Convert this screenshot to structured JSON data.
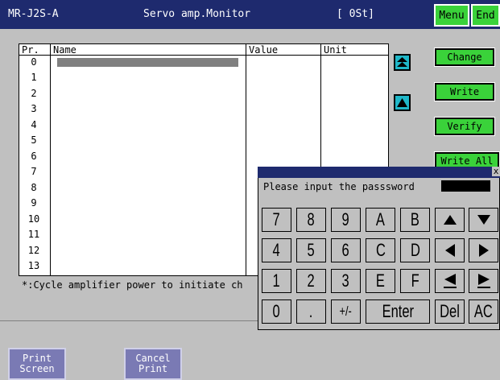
{
  "header": {
    "model": "MR-J2S-A",
    "title": "Servo amp.Monitor",
    "status": "[ 0St]",
    "menu_label": "Menu",
    "end_label": "End"
  },
  "table": {
    "columns": [
      "Pr.",
      "Name",
      "Value",
      "Unit"
    ],
    "rows": [
      "0",
      "1",
      "2",
      "3",
      "4",
      "5",
      "6",
      "7",
      "8",
      "9",
      "10",
      "11",
      "12",
      "13"
    ]
  },
  "side_buttons": {
    "change": "Change",
    "write": "Write",
    "verify": "Verify",
    "write_all": "Write All"
  },
  "note": "*:Cycle amplifier power to initiate ch",
  "footer": {
    "print_screen": [
      "Print",
      "Screen"
    ],
    "cancel_print": [
      "Cancel",
      "Print"
    ]
  },
  "dialog": {
    "close": "x",
    "prompt": "Please input the passsword",
    "keys": {
      "row1": [
        "7",
        "8",
        "9",
        "A",
        "B"
      ],
      "row2": [
        "4",
        "5",
        "6",
        "C",
        "D"
      ],
      "row3": [
        "1",
        "2",
        "3",
        "E",
        "F"
      ],
      "row4": [
        "0",
        ".",
        "+/-",
        "Enter",
        "Del",
        "AC"
      ]
    }
  },
  "icons": {
    "top": "double-up-arrow-icon",
    "up": "up-arrow-icon",
    "keypad_up": "triangle-up-icon",
    "keypad_down": "triangle-down-icon",
    "keypad_left": "triangle-left-icon",
    "keypad_right": "triangle-right-icon",
    "keypad_end_left": "underlined-triangle-left-icon",
    "keypad_end_right": "underlined-triangle-right-icon"
  },
  "colors": {
    "title_bar": "#1e2a6e",
    "green_button": "#3ad23a",
    "cyan_button": "#1fb7c8",
    "print_button": "#7a7ab4",
    "background": "#c0c0c0"
  }
}
